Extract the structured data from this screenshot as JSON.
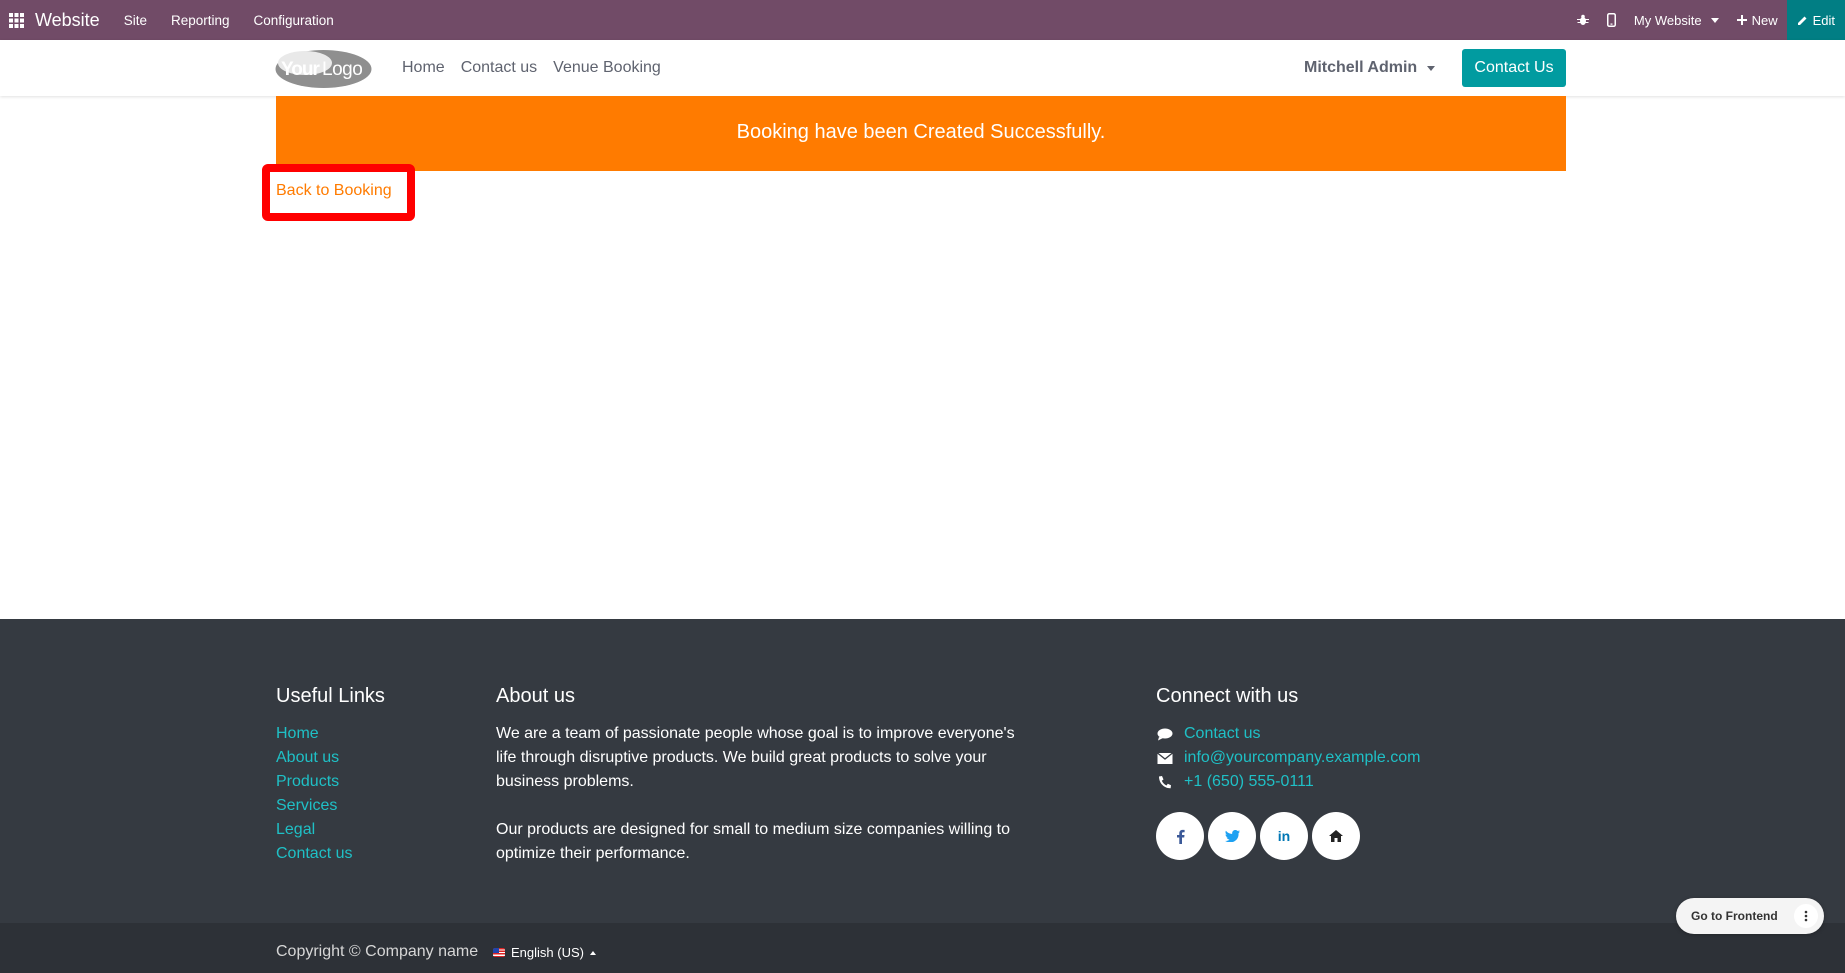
{
  "topbar": {
    "app_name": "Website",
    "menu": [
      "Site",
      "Reporting",
      "Configuration"
    ],
    "website_selector": "My Website",
    "new_label": "New",
    "edit_label": "Edit",
    "bg_color": "#714b67",
    "edit_color": "#017e84"
  },
  "header": {
    "logo_text": "YourLogo",
    "nav": [
      "Home",
      "Contact us",
      "Venue Booking"
    ],
    "user_name": "Mitchell Admin",
    "contact_button": "Contact Us",
    "button_color": "#019ba0"
  },
  "main": {
    "banner_text": "Booking have been Created Successfully.",
    "banner_color": "#ff7b00",
    "back_link": "Back to Booking",
    "highlight_color": "#ff0000"
  },
  "footer": {
    "useful_links_title": "Useful Links",
    "useful_links": [
      "Home",
      "About us",
      "Products",
      "Services",
      "Legal",
      "Contact us"
    ],
    "about_title": "About us",
    "about_p1": "We are a team of passionate people whose goal is to improve everyone's life through disruptive products. We build great products to solve your business problems.",
    "about_p2": "Our products are designed for small to medium size companies willing to optimize their performance.",
    "connect_title": "Connect with us",
    "connect_contact": "Contact us",
    "connect_email": "info@yourcompany.example.com",
    "connect_phone": "+1 (650) 555-0111",
    "socials": [
      "facebook-icon",
      "twitter-icon",
      "linkedin-icon",
      "home-icon"
    ],
    "link_color": "#1fc0c6"
  },
  "bottom": {
    "copyright": "Copyright © Company name",
    "language": "English (US)"
  },
  "floating": {
    "go_to_frontend": "Go to Frontend"
  }
}
